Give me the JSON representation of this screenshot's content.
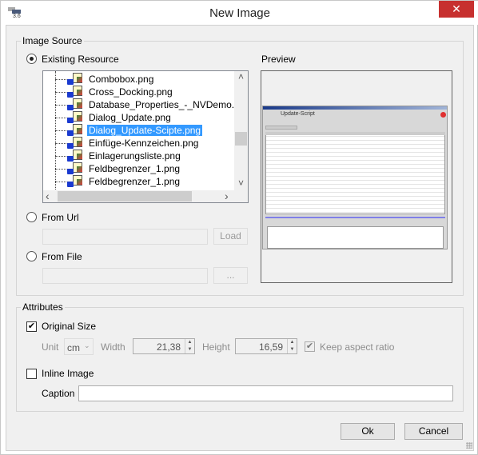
{
  "window": {
    "title": "New Image",
    "app_icon_label": "3.6",
    "close_glyph": "✕"
  },
  "image_source": {
    "group_label": "Image Source",
    "existing_resource": {
      "label": "Existing Resource",
      "selected": true
    },
    "tree": {
      "items": [
        {
          "label": "Combobox.png",
          "selected": false
        },
        {
          "label": "Cross_Docking.png",
          "selected": false
        },
        {
          "label": "Database_Properties_-_NVDemo.png",
          "selected": false
        },
        {
          "label": "Dialog_Update.png",
          "selected": false
        },
        {
          "label": "Dialog_Update-Scipte.png",
          "selected": true
        },
        {
          "label": "Einfüge-Kennzeichen.png",
          "selected": false
        },
        {
          "label": "Einlagerungsliste.png",
          "selected": false
        },
        {
          "label": "Feldbegrenzer_1.png",
          "selected": false
        },
        {
          "label": "Feldbegrenzer_1.png",
          "selected": false
        }
      ],
      "item_icon": "locked-image-resource-icon",
      "scroll_up": "˄",
      "scroll_down": "˅",
      "scroll_left": "‹",
      "scroll_right": "›"
    },
    "from_url": {
      "label": "From Url",
      "selected": false,
      "value": "",
      "button_label": "Load"
    },
    "from_file": {
      "label": "From File",
      "selected": false,
      "value": "",
      "button_label": "..."
    },
    "preview": {
      "label": "Preview",
      "image_title": "Update-Script"
    }
  },
  "attributes": {
    "group_label": "Attributes",
    "original_size": {
      "label": "Original Size",
      "checked": true
    },
    "unit": {
      "label": "Unit",
      "value": "cm"
    },
    "width": {
      "label": "Width",
      "value": "21,38"
    },
    "height": {
      "label": "Height",
      "value": "16,59"
    },
    "keep_aspect": {
      "label": "Keep aspect ratio",
      "checked": true
    },
    "inline_image": {
      "label": "Inline Image",
      "checked": false
    },
    "caption": {
      "label": "Caption",
      "value": ""
    }
  },
  "buttons": {
    "ok": "Ok",
    "cancel": "Cancel"
  },
  "colors": {
    "selection": "#3399ff",
    "close": "#c7302f",
    "dialog_bg": "#f0f0f0"
  }
}
